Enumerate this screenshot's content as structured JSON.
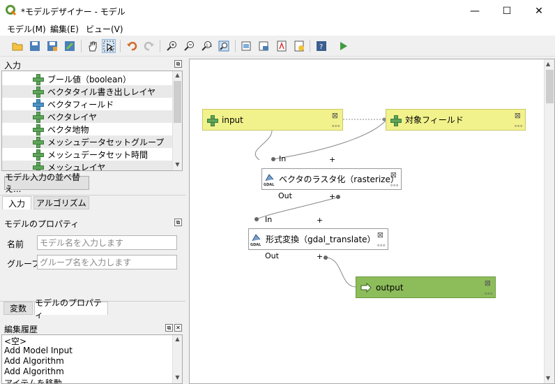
{
  "window": {
    "title": "*モデルデザイナー - モデル",
    "minimize": "—",
    "maximize": "☐",
    "close": "✕"
  },
  "menu": {
    "model": "モデル(M)",
    "edit": "編集(E)",
    "view": "ビュー(V)"
  },
  "inputs_panel": {
    "title": "入力",
    "items": [
      {
        "label": "ブール値（boolean）",
        "icon": "plus-icon"
      },
      {
        "label": "ベクタタイル書き出しレイヤ",
        "icon": "plus-icon"
      },
      {
        "label": "ベクタフィールド",
        "icon": "plus-blue-icon"
      },
      {
        "label": "ベクタレイヤ",
        "icon": "plus-icon"
      },
      {
        "label": "ベクタ地物",
        "icon": "plus-icon"
      },
      {
        "label": "メッシュデータセットグループ",
        "icon": "plus-icon"
      },
      {
        "label": "メッシュデータセット時間",
        "icon": "plus-icon"
      },
      {
        "label": "メッシュレイヤ",
        "icon": "plus-icon"
      }
    ],
    "reorder_button": "モデル入力の並べ替え...",
    "tabs": [
      "入力",
      "アルゴリズム"
    ]
  },
  "model_properties": {
    "title": "モデルのプロパティ",
    "name_label": "名前",
    "name_placeholder": "モデル名を入力します",
    "group_label": "グループ",
    "group_placeholder": "グループ名を入力します",
    "tabs": [
      "変数",
      "モデルのプロパティ"
    ]
  },
  "history": {
    "title": "編集履歴",
    "items": [
      "<空>",
      "Add Model Input",
      "Add Algorithm",
      "Add Algorithm",
      "アイテムを移動"
    ]
  },
  "canvas": {
    "node_input": "input",
    "node_field": "対象フィールド",
    "node_rasterize": "ベクタのラスタ化（rasterize）",
    "node_translate": "形式変換（gdal_translate）",
    "node_output": "output",
    "port_in": "In",
    "port_out": "Out",
    "port_plus": "+",
    "close_glyph": "⊠",
    "dots_glyph": "∘∘∘"
  },
  "colors": {
    "input_node": "#f2f28c",
    "output_node": "#8dbd5b",
    "accent_green": "#5ea65a"
  }
}
